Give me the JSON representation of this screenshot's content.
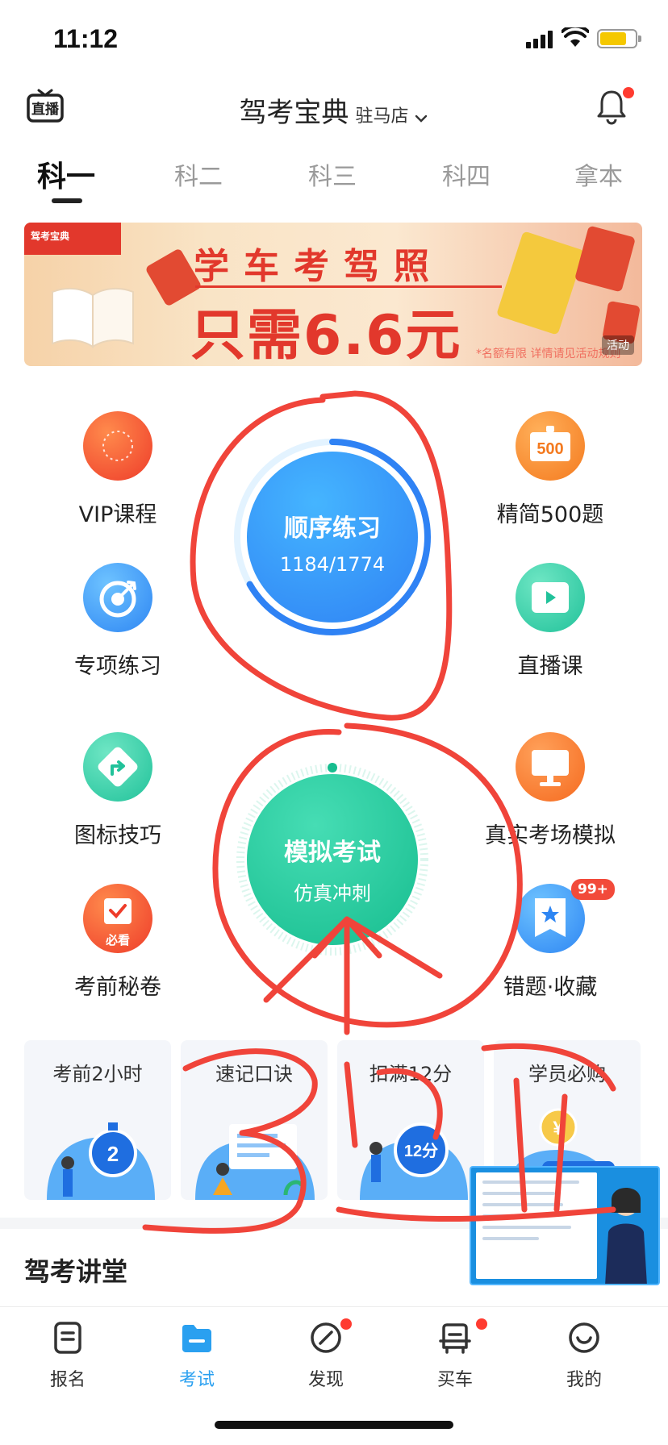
{
  "status_bar": {
    "time": "11:12"
  },
  "header": {
    "live_icon_label": "直播",
    "title": "驾考宝典",
    "store": "驻马店",
    "icons": [
      "live-logo-icon",
      "chevron-down-icon",
      "bell-icon"
    ]
  },
  "subject_tabs": [
    {
      "label": "科一",
      "active": true
    },
    {
      "label": "科二",
      "active": false
    },
    {
      "label": "科三",
      "active": false
    },
    {
      "label": "科四",
      "active": false
    },
    {
      "label": "拿本",
      "active": false
    }
  ],
  "banner": {
    "brand": "驾考宝典",
    "line1": "学车考驾照",
    "line2": "只需6.6元",
    "note": "*名额有限 详情请见活动规则",
    "tag": "活动"
  },
  "features": {
    "left": [
      "VIP课程",
      "专项练习",
      "图标技巧",
      "考前秘卷"
    ],
    "right": [
      "精简500题",
      "直播课",
      "真实考场模拟",
      "错题·收藏"
    ],
    "badge_bikan": "必看",
    "badge_count": "99+",
    "icon_500_text": "500"
  },
  "sequence_practice": {
    "label": "顺序练习",
    "progress": "1184/1774",
    "progress_fraction": 0.667
  },
  "mock_exam": {
    "label": "模拟考试",
    "sublabel": "仿真冲刺"
  },
  "cards": [
    {
      "label": "考前2小时",
      "art_text": "2"
    },
    {
      "label": "速记口诀",
      "art_text": ""
    },
    {
      "label": "扣满12分",
      "art_text": "12分"
    },
    {
      "label": "学员必购",
      "art_text": "¥"
    }
  ],
  "section": {
    "title": "驾考讲堂"
  },
  "tab_bar": [
    {
      "label": "报名",
      "active": false,
      "dot": false
    },
    {
      "label": "考试",
      "active": true,
      "dot": false
    },
    {
      "label": "发现",
      "active": false,
      "dot": true
    },
    {
      "label": "买车",
      "active": false,
      "dot": true
    },
    {
      "label": "我的",
      "active": false,
      "dot": false
    }
  ],
  "annotation": {
    "handwritten_text": "3遍"
  },
  "colors": {
    "accent_blue": "#2aa0f0",
    "primary_blue": "#2f82f4",
    "primary_green": "#17bd8f",
    "banner_red": "#e2382c",
    "annotation_red": "#f0443a"
  }
}
